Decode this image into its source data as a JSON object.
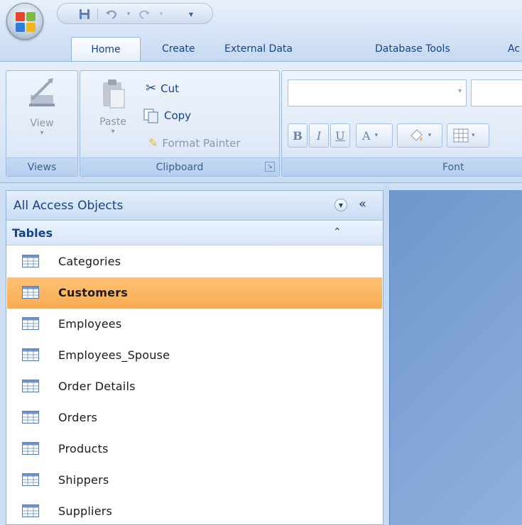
{
  "tabs": [
    {
      "label": "Home",
      "active": true
    },
    {
      "label": "Create",
      "active": false
    },
    {
      "label": "External Data",
      "active": false
    },
    {
      "label": "Database Tools",
      "active": false
    },
    {
      "label": "Ac",
      "active": false
    }
  ],
  "ribbon": {
    "views": {
      "group_label": "Views",
      "view_label": "View"
    },
    "clipboard": {
      "group_label": "Clipboard",
      "paste_label": "Paste",
      "cut_label": "Cut",
      "copy_label": "Copy",
      "format_painter_label": "Format Painter"
    },
    "font": {
      "group_label": "Font",
      "bold": "B",
      "italic": "I",
      "underline": "U",
      "font_color": "A"
    }
  },
  "nav": {
    "title": "All Access Objects",
    "group_label": "Tables",
    "items": [
      {
        "label": "Categories",
        "selected": false
      },
      {
        "label": "Customers",
        "selected": true
      },
      {
        "label": "Employees",
        "selected": false
      },
      {
        "label": "Employees_Spouse",
        "selected": false
      },
      {
        "label": "Order Details",
        "selected": false
      },
      {
        "label": "Orders",
        "selected": false
      },
      {
        "label": "Products",
        "selected": false
      },
      {
        "label": "Shippers",
        "selected": false
      },
      {
        "label": "Suppliers",
        "selected": false
      }
    ]
  },
  "colors": {
    "selected_row": "#f8ab51",
    "text_blue": "#15428b",
    "doc_area": "#7ba0d4"
  }
}
